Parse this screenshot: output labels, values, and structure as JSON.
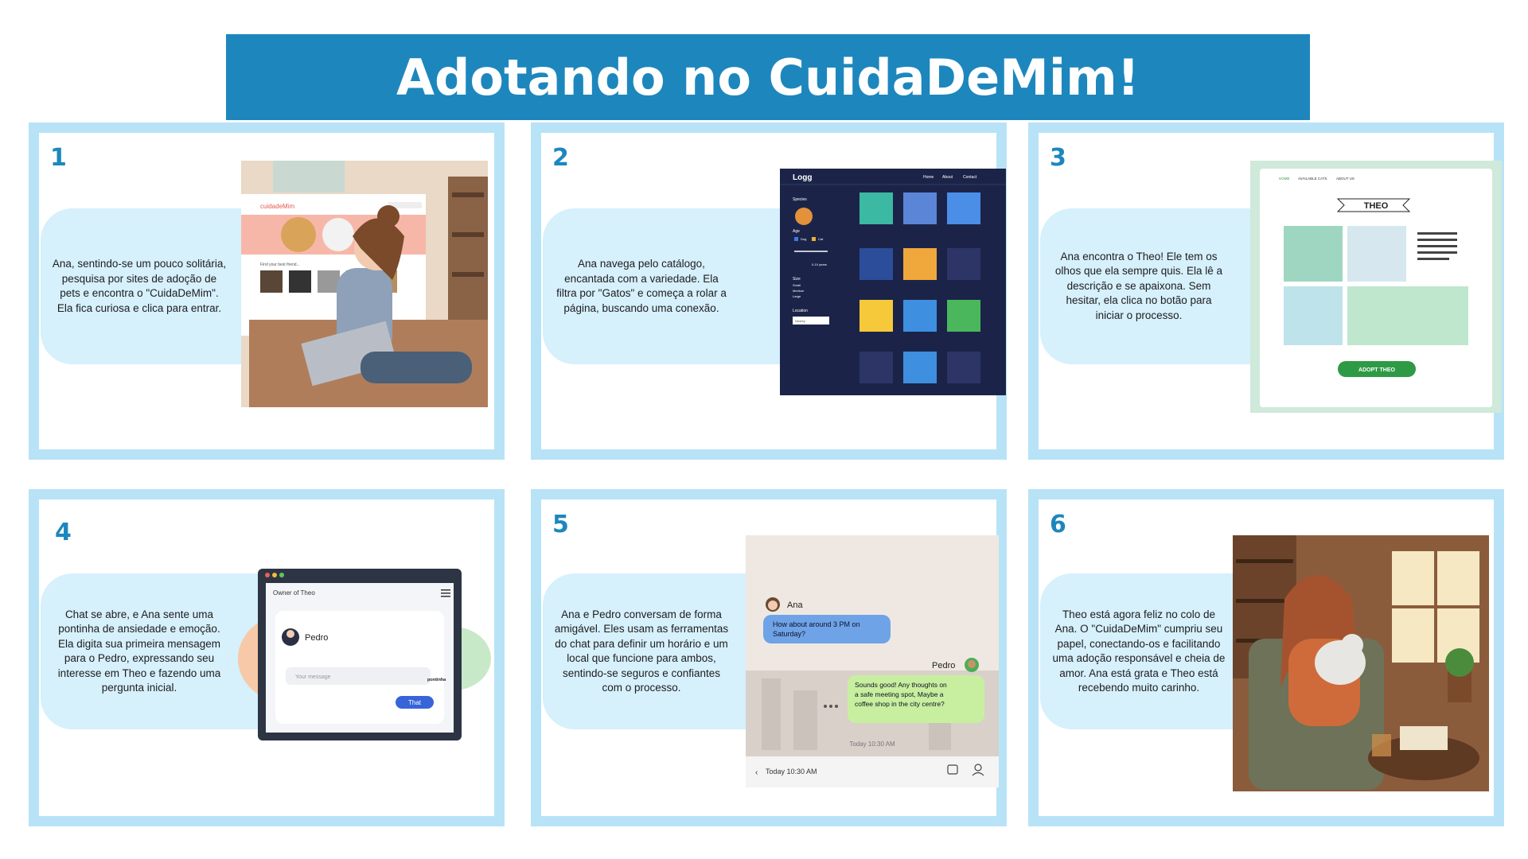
{
  "title": "Adotando no CuidaDeMim!",
  "panels": [
    {
      "number": "1",
      "text": "Ana, sentindo-se um pouco solitária, pesquisa por sites de adoção de pets e encontra o \"CuidaDeMim\". Ela fica curiosa e clica para entrar.",
      "site_logo": "cuidadeMim",
      "site_subtitle": "Find your best friend..."
    },
    {
      "number": "2",
      "text": "Ana navega pelo catálogo, encantada com a variedade. Ela filtra por \"Gatos\" e começa a rolar a página, buscando uma conexão.",
      "app_logo": "Logg",
      "nav": [
        "Home",
        "About",
        "Contact"
      ],
      "filters": {
        "species": "Species",
        "age": "Age",
        "dog": "Dog",
        "cat": "Cat",
        "age_range": "0-10 years",
        "size": "Size",
        "sizes": [
          "Small",
          "Medium",
          "Large"
        ],
        "location": "Location",
        "location_value": "Nearby"
      }
    },
    {
      "number": "3",
      "text": "Ana encontra o Theo! Ele tem os olhos que ela sempre quis. Ela lê a descrição e se apaixona. Sem hesitar, ela clica no botão para iniciar o processo.",
      "nav": [
        "HOME",
        "AVAILABLE CATS",
        "ABOUT US"
      ],
      "banner": "THEO",
      "button": "ADOPT THEO"
    },
    {
      "number": "4",
      "text": "Chat se abre, e Ana sente uma pontinha de ansiedade e emoção. Ela digita sua primeira mensagem para o Pedro, expressando seu interesse em Theo e fazendo uma pergunta inicial.",
      "chat_header": "Owner of Theo",
      "contact": "Pedro",
      "input_placeholder": "Your message",
      "input_side_label": "pontinha",
      "send_button": "That"
    },
    {
      "number": "5",
      "text": "Ana e Pedro conversam de forma amigável. Eles usam as ferramentas do chat para definir um horário e um local que funcione para ambos, sentindo-se seguros e confiantes com o processo.",
      "user_a": "Ana",
      "msg_a": "How about around 3 PM on Saturday?",
      "user_b": "Pedro",
      "msg_b": "Sounds good! Any thoughts on a safe meeting spot, Maybe a coffee shop in the city centre?",
      "timestamp": "Today 10:30 AM",
      "footer_time": "Today 10:30 AM"
    },
    {
      "number": "6",
      "text": "Theo está agora feliz no colo de Ana. O \"CuidaDeMim\" cumpriu seu papel, conectando-os e facilitando uma adoção responsável e cheia de amor. Ana está grata e Theo está recebendo muito carinho."
    }
  ]
}
